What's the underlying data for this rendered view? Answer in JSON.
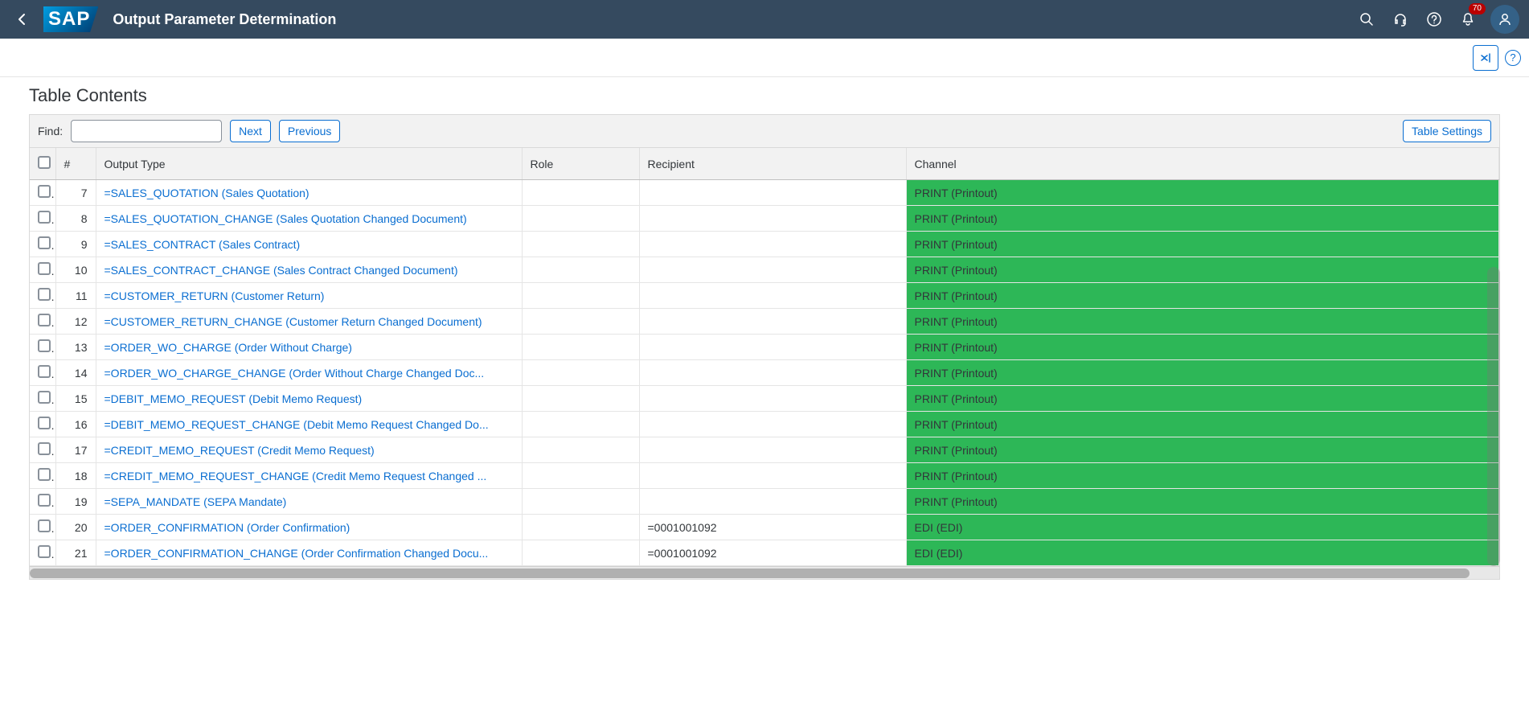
{
  "header": {
    "logo_text": "SAP",
    "title": "Output Parameter Determination",
    "notification_count": "70"
  },
  "section_title": "Table Contents",
  "toolbar": {
    "find_label": "Find:",
    "find_value": "",
    "next_label": "Next",
    "previous_label": "Previous",
    "table_settings_label": "Table Settings"
  },
  "columns": {
    "num": "#",
    "output_type": "Output Type",
    "role": "Role",
    "recipient": "Recipient",
    "channel": "Channel"
  },
  "rows": [
    {
      "num": "7",
      "output_type": "=SALES_QUOTATION (Sales Quotation)",
      "role": "",
      "recipient": "",
      "channel": "PRINT (Printout)"
    },
    {
      "num": "8",
      "output_type": "=SALES_QUOTATION_CHANGE (Sales Quotation Changed Document)",
      "role": "",
      "recipient": "",
      "channel": "PRINT (Printout)"
    },
    {
      "num": "9",
      "output_type": "=SALES_CONTRACT (Sales Contract)",
      "role": "",
      "recipient": "",
      "channel": "PRINT (Printout)"
    },
    {
      "num": "10",
      "output_type": "=SALES_CONTRACT_CHANGE (Sales Contract Changed Document)",
      "role": "",
      "recipient": "",
      "channel": "PRINT (Printout)"
    },
    {
      "num": "11",
      "output_type": "=CUSTOMER_RETURN (Customer Return)",
      "role": "",
      "recipient": "",
      "channel": "PRINT (Printout)"
    },
    {
      "num": "12",
      "output_type": "=CUSTOMER_RETURN_CHANGE (Customer Return Changed Document)",
      "role": "",
      "recipient": "",
      "channel": "PRINT (Printout)"
    },
    {
      "num": "13",
      "output_type": "=ORDER_WO_CHARGE (Order Without Charge)",
      "role": "",
      "recipient": "",
      "channel": "PRINT (Printout)"
    },
    {
      "num": "14",
      "output_type": "=ORDER_WO_CHARGE_CHANGE (Order Without Charge Changed Doc...",
      "role": "",
      "recipient": "",
      "channel": "PRINT (Printout)"
    },
    {
      "num": "15",
      "output_type": "=DEBIT_MEMO_REQUEST (Debit Memo Request)",
      "role": "",
      "recipient": "",
      "channel": "PRINT (Printout)"
    },
    {
      "num": "16",
      "output_type": "=DEBIT_MEMO_REQUEST_CHANGE (Debit Memo Request Changed Do...",
      "role": "",
      "recipient": "",
      "channel": "PRINT (Printout)"
    },
    {
      "num": "17",
      "output_type": "=CREDIT_MEMO_REQUEST (Credit Memo Request)",
      "role": "",
      "recipient": "",
      "channel": "PRINT (Printout)"
    },
    {
      "num": "18",
      "output_type": "=CREDIT_MEMO_REQUEST_CHANGE (Credit Memo Request Changed ...",
      "role": "",
      "recipient": "",
      "channel": "PRINT (Printout)"
    },
    {
      "num": "19",
      "output_type": "=SEPA_MANDATE (SEPA Mandate)",
      "role": "",
      "recipient": "",
      "channel": "PRINT (Printout)"
    },
    {
      "num": "20",
      "output_type": "=ORDER_CONFIRMATION (Order Confirmation)",
      "role": "",
      "recipient": "=0001001092",
      "channel": "EDI (EDI)"
    },
    {
      "num": "21",
      "output_type": "=ORDER_CONFIRMATION_CHANGE (Order Confirmation Changed Docu...",
      "role": "",
      "recipient": "=0001001092",
      "channel": "EDI (EDI)"
    }
  ]
}
